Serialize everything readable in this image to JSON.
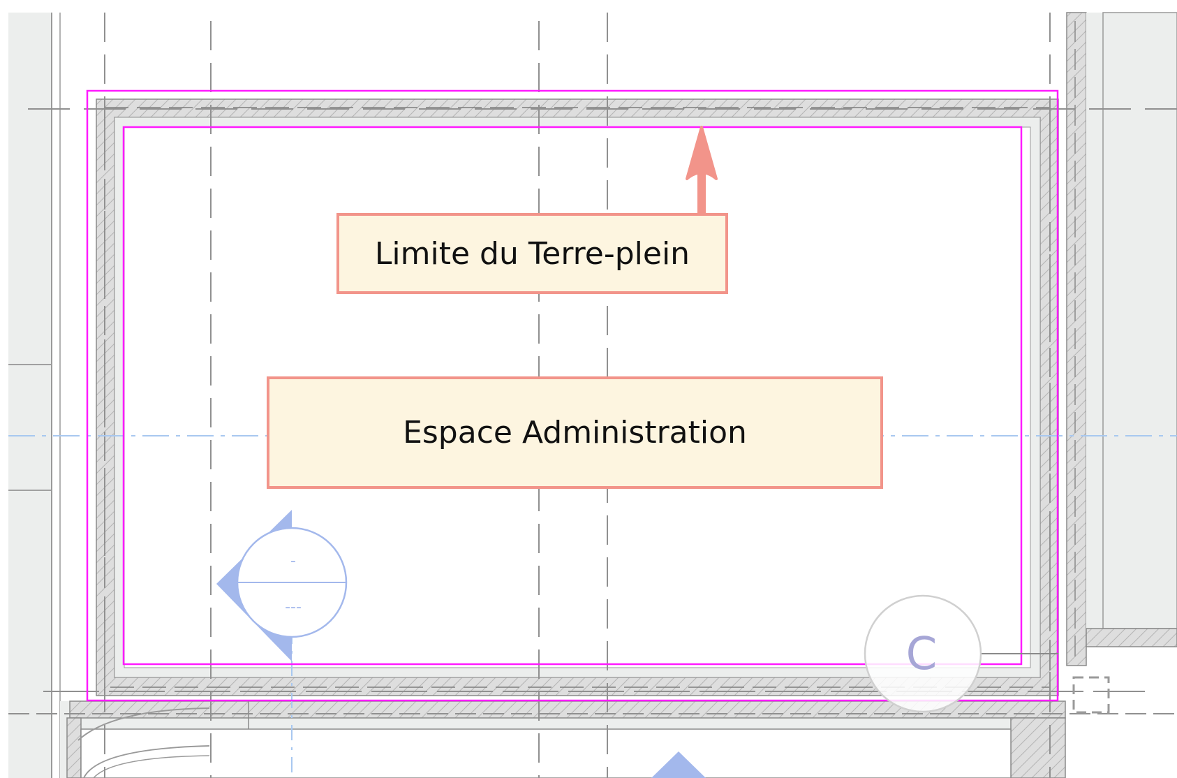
{
  "annotations": {
    "boundary_label": "Limite du Terre-plein",
    "space_label": "Espace Administration"
  },
  "plan_symbols": {
    "section_marker_top": "-",
    "section_marker_bottom": "---",
    "grid_bubble_label": "C"
  },
  "colors": {
    "boundary_line": "#ff1aff",
    "callout_border": "#f2948a",
    "callout_fill": "#fdf5e0",
    "arrow": "#f2948a",
    "wall_fill": "#dedede",
    "grid_line": "#909090",
    "ref_line": "#a8c8f0",
    "section_marker": "#a3b8ec"
  }
}
